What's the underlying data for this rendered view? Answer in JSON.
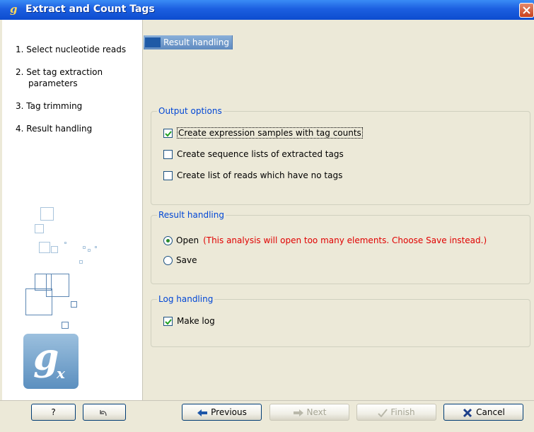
{
  "window": {
    "title": "Extract and Count Tags",
    "icon": "gx-app-icon"
  },
  "steps": [
    {
      "label": "1.  Select nucleotide reads"
    },
    {
      "label": "2.  Set tag extraction",
      "label2": "parameters"
    },
    {
      "label": "3.  Tag trimming"
    },
    {
      "label": "4.  Result handling"
    }
  ],
  "header": {
    "title": "Result handling"
  },
  "output_options": {
    "title": "Output options",
    "items": [
      {
        "label": "Create expression samples with tag counts",
        "checked": true
      },
      {
        "label": "Create sequence lists of extracted tags",
        "checked": false
      },
      {
        "label": "Create list of reads which have no tags",
        "checked": false
      }
    ]
  },
  "result_handling": {
    "title": "Result handling",
    "open_label": "Open",
    "open_warning": "(This analysis will open too many elements. Choose Save instead.)",
    "save_label": "Save",
    "selected": "Open"
  },
  "log_handling": {
    "title": "Log handling",
    "make_log_label": "Make log",
    "checked": true
  },
  "buttons": {
    "help": "?",
    "previous": "Previous",
    "next": "Next",
    "finish": "Finish",
    "cancel": "Cancel"
  },
  "colors": {
    "accent": "#0046d5",
    "warning": "#e00000",
    "titlebar": "#1c5fe0"
  }
}
